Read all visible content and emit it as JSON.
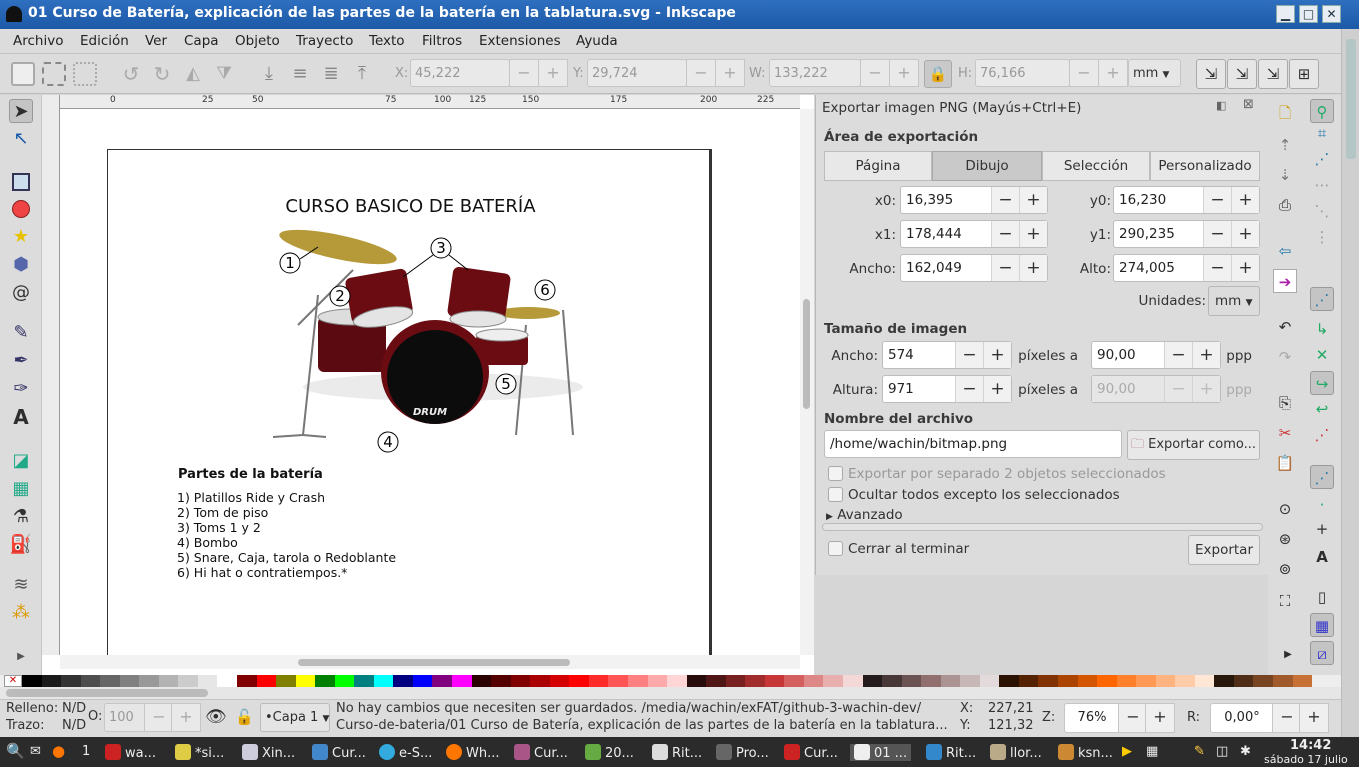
{
  "titlebar": {
    "title": "01 Curso de Batería, explicación de las partes de la batería en la tablatura.svg - Inkscape",
    "min": "▁",
    "max": "□",
    "close": "✕"
  },
  "menu": [
    "Archivo",
    "Edición",
    "Ver",
    "Capa",
    "Objeto",
    "Trayecto",
    "Texto",
    "Filtros",
    "Extensiones",
    "Ayuda"
  ],
  "toolbar": {
    "x_label": "X:",
    "x_value": "45,222",
    "y_label": "Y:",
    "y_value": "29,724",
    "w_label": "W:",
    "w_value": "133,222",
    "h_label": "H:",
    "h_value": "76,166",
    "units": "mm",
    "minus": "−",
    "plus": "+"
  },
  "ruler": [
    "0",
    "25",
    "50",
    "75",
    "100",
    "125",
    "150",
    "175",
    "200",
    "225"
  ],
  "document": {
    "title": "CURSO BASICO DE BATERÍA",
    "callouts": [
      "1",
      "2",
      "3",
      "4",
      "5",
      "6"
    ],
    "drum_logo": "DRUM",
    "parts_heading": "Partes de la batería",
    "parts": [
      "1) Platillos Ride y Crash",
      "2) Tom de piso",
      "3) Toms 1 y 2",
      "4) Bombo",
      "5) Snare, Caja, tarola o Redoblante",
      "6) Hi hat o contratiempos.*"
    ]
  },
  "dialog": {
    "title": "Exportar imagen PNG (Mayús+Ctrl+E)",
    "area_heading": "Área de exportación",
    "tabs": [
      "Página",
      "Dibujo",
      "Selección",
      "Personalizado"
    ],
    "active_tab": "Dibujo",
    "x0_label": "x0:",
    "x0": "16,395",
    "y0_label": "y0:",
    "y0": "16,230",
    "x1_label": "x1:",
    "x1": "178,444",
    "y1_label": "y1:",
    "y1": "290,235",
    "ancho_label": "Ancho:",
    "ancho": "162,049",
    "alto_label": "Alto:",
    "alto": "274,005",
    "units_label": "Unidades:",
    "units": "mm",
    "size_heading": "Tamaño de imagen",
    "img_ancho_label": "Ancho:",
    "img_ancho": "574",
    "img_altura_label": "Altura:",
    "img_altura": "971",
    "pixels_at": "píxeles a",
    "dpi1": "90,00",
    "dpi2": "90,00",
    "ppp": "ppp",
    "file_heading": "Nombre del archivo",
    "filename": "/home/wachin/bitmap.png",
    "export_as": "Exportar como...",
    "chk_separate": "Exportar por separado 2 objetos seleccionados",
    "chk_hide": "Ocultar todos excepto los seleccionados",
    "advanced": "Avanzado",
    "chk_close": "Cerrar al terminar",
    "export_btn": "Exportar"
  },
  "palette_colors": [
    "#000000",
    "#1a1a1a",
    "#333333",
    "#4d4d4d",
    "#666666",
    "#808080",
    "#999999",
    "#b3b3b3",
    "#cccccc",
    "#e6e6e6",
    "#ffffff",
    "#800000",
    "#ff0000",
    "#808000",
    "#ffff00",
    "#008000",
    "#00ff00",
    "#008080",
    "#00ffff",
    "#000080",
    "#0000ff",
    "#800080",
    "#ff00ff",
    "#2b0000",
    "#550000",
    "#800000",
    "#aa0000",
    "#d40000",
    "#ff0000",
    "#ff2a2a",
    "#ff5555",
    "#ff8080",
    "#ffaaaa",
    "#ffd5d5",
    "#280b0b",
    "#501616",
    "#782121",
    "#a02c2c",
    "#c83737",
    "#d35f5f",
    "#de8787",
    "#e9afaf",
    "#f4d7d7",
    "#241c1c",
    "#483737",
    "#6c5353",
    "#916f6f",
    "#ac9393",
    "#c8b7b7",
    "#e3dbdb",
    "#2b1100",
    "#552200",
    "#803300",
    "#aa4400",
    "#d45500",
    "#ff6600",
    "#ff7f2a",
    "#ff9955",
    "#ffb380",
    "#ffccaa",
    "#ffe6d5",
    "#28170b",
    "#502d16",
    "#784421",
    "#a05a2c",
    "#c87137"
  ],
  "status": {
    "fill_label": "Relleno:",
    "fill_val": "N/D",
    "stroke_label": "Trazo:",
    "stroke_val": "N/D",
    "o_label": "O:",
    "opacity": "100",
    "layer": "•Capa 1",
    "message_line1": "No hay cambios que necesiten ser guardados. /media/wachin/exFAT/github-3-wachin-dev/",
    "message_line2": "Curso-de-bateria/01 Curso de Batería, explicación de las partes de la batería en la tablatura....",
    "x_label": "X:",
    "x": "227,21",
    "y_label": "Y:",
    "y": "121,32",
    "z_label": "Z:",
    "zoom": "76%",
    "r_label": "R:",
    "rotation": "0,00°"
  },
  "taskbar": {
    "items": [
      "1",
      "wa...",
      "*si...",
      "Xin...",
      "Cur...",
      "e-S...",
      "Wh...",
      "Cur...",
      "20...",
      "Rit...",
      "Pro...",
      "Cur...",
      "01 ...",
      "Rit...",
      "llor...",
      "ksn..."
    ],
    "time": "14:42",
    "date": "sábado 17 julio"
  }
}
